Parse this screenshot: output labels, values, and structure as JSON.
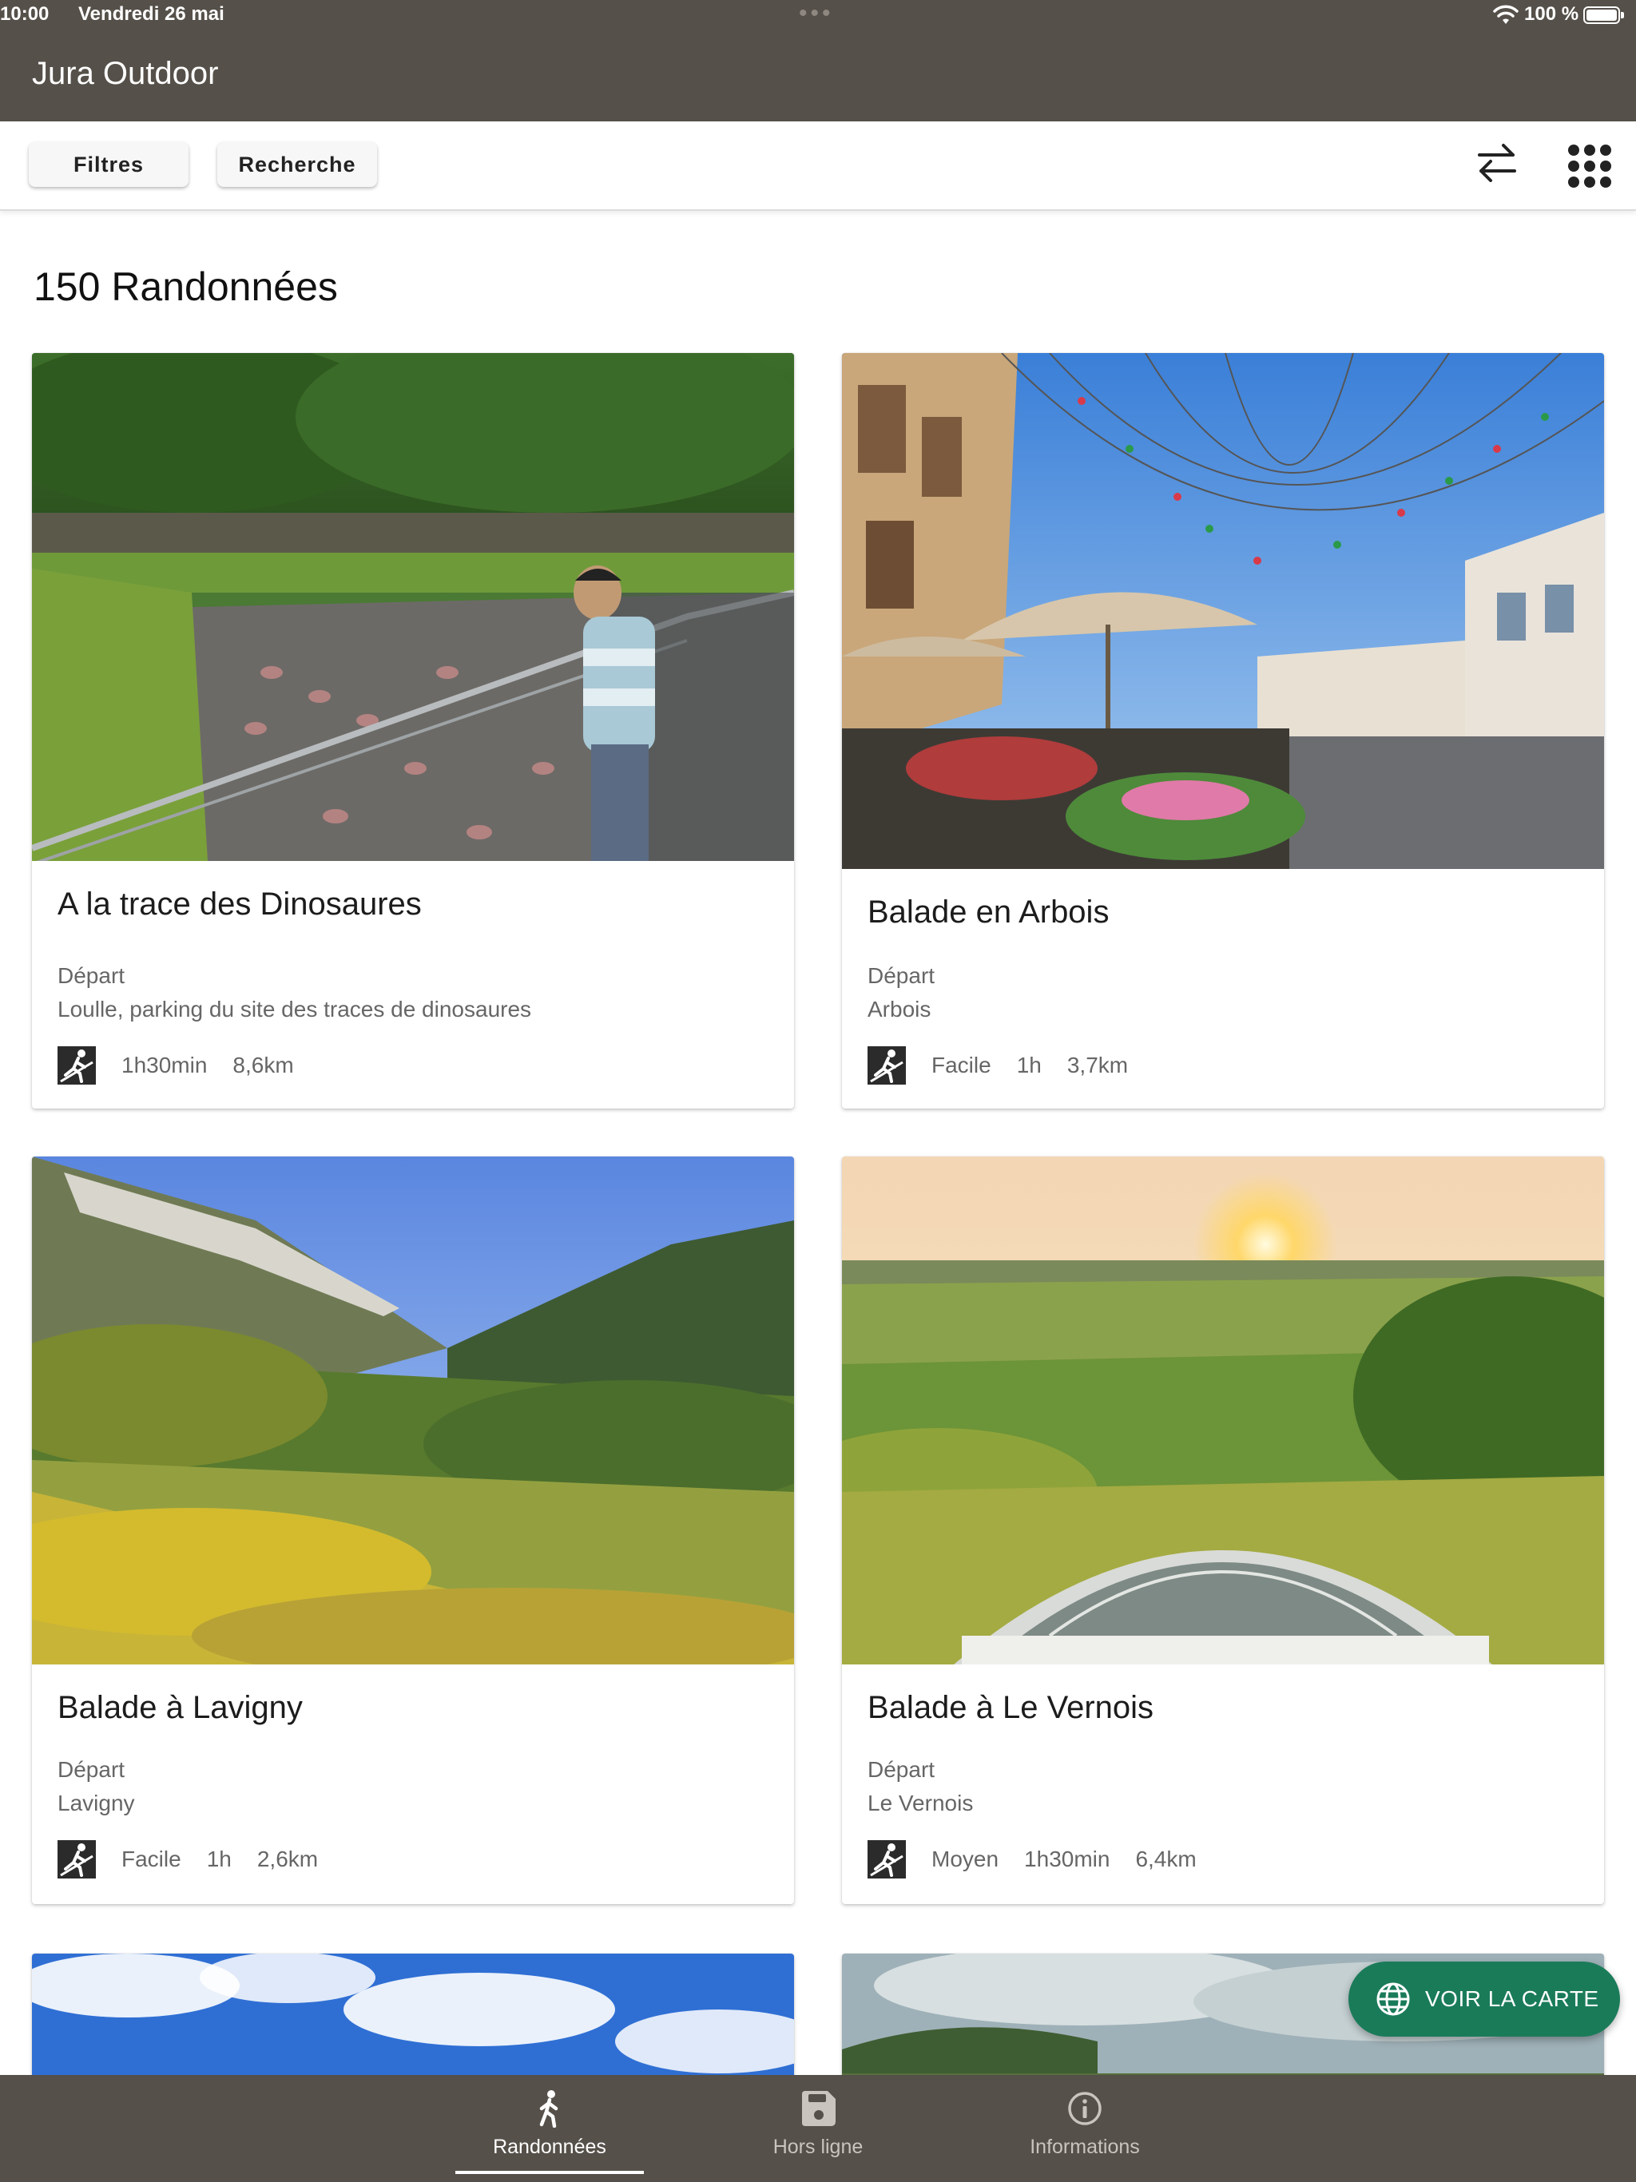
{
  "status_bar": {
    "time": "10:00",
    "date": "Vendredi 26 mai",
    "battery": "100 %"
  },
  "app": {
    "title": "Jura Outdoor"
  },
  "toolbar": {
    "filters_label": "Filtres",
    "search_label": "Recherche",
    "sort_icon": "swap-arrows-icon",
    "view_icon": "grid-dots-icon"
  },
  "list": {
    "count_heading": "150 Randonnées",
    "cards": [
      {
        "title": "A la trace des Dinosaures",
        "depart_label": "Départ",
        "depart": "Loulle, parking du site des traces de dinosaures",
        "difficulty": "",
        "duration": "1h30min",
        "distance": "8,6km",
        "image": "photo of a man leaning on a railing above a rock slab with dinosaur footprints"
      },
      {
        "title": "Balade en Arbois",
        "depart_label": "Départ",
        "depart": "Arbois",
        "difficulty": "Facile",
        "duration": "1h",
        "distance": "3,7km",
        "image": "photo of a town square with café terrace and bunting flags"
      },
      {
        "title": "Balade à Lavigny",
        "depart_label": "Départ",
        "depart": "Lavigny",
        "difficulty": "Facile",
        "duration": "1h",
        "distance": "2,6km",
        "image": "photo of a valley with vineyards and limestone cliffs"
      },
      {
        "title": "Balade à Le Vernois",
        "depart_label": "Départ",
        "depart": "Le Vernois",
        "difficulty": "Moyen",
        "duration": "1h30min",
        "distance": "6,4km",
        "image": "photo of an orientation table at sunset over vineyards"
      }
    ]
  },
  "map_button": {
    "label": "VOIR LA CARTE",
    "icon": "globe-icon"
  },
  "tabbar": {
    "tabs": [
      {
        "label": "Randonnées",
        "icon": "hiker-icon",
        "active": true
      },
      {
        "label": "Hors ligne",
        "icon": "save-disk-icon",
        "active": false
      },
      {
        "label": "Informations",
        "icon": "info-icon",
        "active": false
      }
    ]
  },
  "colors": {
    "header_bg": "#555049",
    "fab_green": "#1a7b59",
    "text_secondary": "#666666"
  }
}
